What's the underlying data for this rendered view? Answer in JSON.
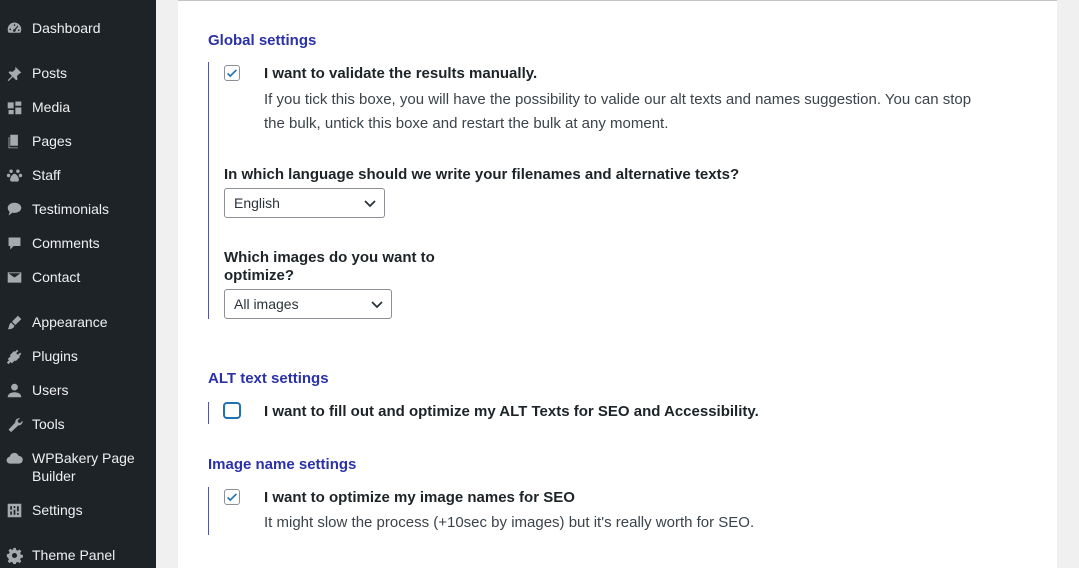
{
  "sidebar": {
    "items": [
      {
        "label": "Dashboard",
        "icon": "dashboard-icon"
      },
      {
        "label": "Posts",
        "icon": "pin-icon"
      },
      {
        "label": "Media",
        "icon": "media-icon"
      },
      {
        "label": "Pages",
        "icon": "pages-icon"
      },
      {
        "label": "Staff",
        "icon": "paw-icon"
      },
      {
        "label": "Testimonials",
        "icon": "speech-bubble-icon"
      },
      {
        "label": "Comments",
        "icon": "comment-icon"
      },
      {
        "label": "Contact",
        "icon": "mail-icon"
      },
      {
        "label": "Appearance",
        "icon": "brush-icon"
      },
      {
        "label": "Plugins",
        "icon": "plug-icon"
      },
      {
        "label": "Users",
        "icon": "user-icon"
      },
      {
        "label": "Tools",
        "icon": "wrench-icon"
      },
      {
        "label": "WPBakery Page Builder",
        "icon": "cloud-icon"
      },
      {
        "label": "Settings",
        "icon": "sliders-icon"
      },
      {
        "label": "Theme Panel",
        "icon": "gear-icon"
      }
    ]
  },
  "global": {
    "title": "Global settings",
    "validate": {
      "label": "I want to validate the results manually.",
      "checked": true,
      "description_line1": "If you tick this boxe, you will have the possibility to valide our alt texts and names suggestion. You can stop",
      "description_line2": "the bulk, untick this boxe and restart the bulk at any moment."
    },
    "language": {
      "question": "In which language should we write your filenames and alternative texts?",
      "selected": "English"
    },
    "images": {
      "question_line1": "Which images do you want to",
      "question_line2": "optimize?",
      "selected": "All images"
    }
  },
  "alt": {
    "title": "ALT text settings",
    "option": {
      "label": "I want to fill out and optimize my ALT Texts for SEO and Accessibility.",
      "checked": false
    }
  },
  "names": {
    "title": "Image name settings",
    "option": {
      "label": "I want to optimize my image names for SEO",
      "checked": true,
      "description": "It might slow the process (+10sec by images) but it's really worth for SEO."
    }
  },
  "colors": {
    "sidebar_bg": "#1d2327",
    "section_title": "#2b31a8",
    "accent": "#2271b1"
  }
}
